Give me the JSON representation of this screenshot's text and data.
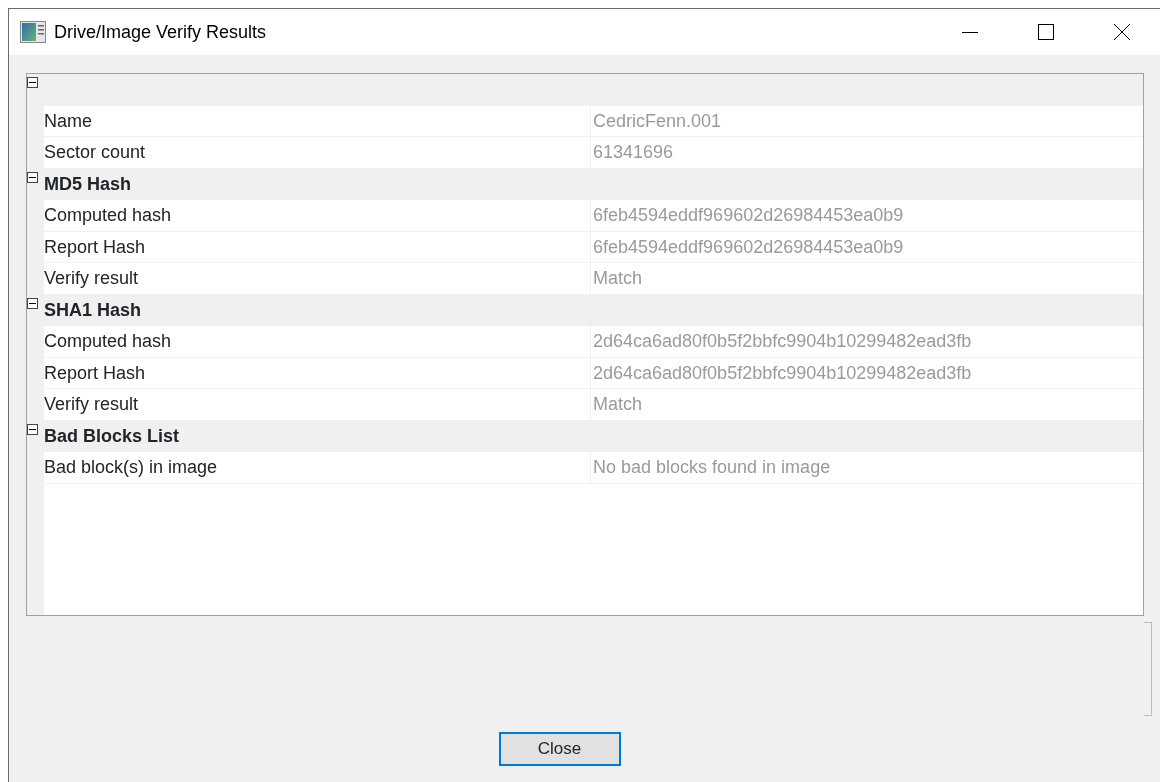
{
  "window": {
    "title": "Drive/Image Verify Results"
  },
  "property_grid": {
    "groups": [
      {
        "expanded": true,
        "rows": [
          {
            "label": "Name",
            "value": "CedricFenn.001"
          },
          {
            "label": "Sector count",
            "value": "61341696"
          }
        ]
      },
      {
        "title": "MD5 Hash",
        "expanded": true,
        "rows": [
          {
            "label": "Computed hash",
            "value": "6feb4594eddf969602d26984453ea0b9"
          },
          {
            "label": "Report Hash",
            "value": "6feb4594eddf969602d26984453ea0b9"
          },
          {
            "label": "Verify result",
            "value": "Match"
          }
        ]
      },
      {
        "title": "SHA1 Hash",
        "expanded": true,
        "rows": [
          {
            "label": "Computed hash",
            "value": "2d64ca6ad80f0b5f2bbfc9904b10299482ead3fb"
          },
          {
            "label": "Report Hash",
            "value": "2d64ca6ad80f0b5f2bbfc9904b10299482ead3fb"
          },
          {
            "label": "Verify result",
            "value": "Match"
          }
        ]
      },
      {
        "title": "Bad Blocks List",
        "expanded": true,
        "rows": [
          {
            "label": "Bad block(s) in image",
            "value": "No bad blocks found in image"
          }
        ]
      }
    ]
  },
  "buttons": [
    {
      "label": "Close",
      "focused": true
    }
  ]
}
